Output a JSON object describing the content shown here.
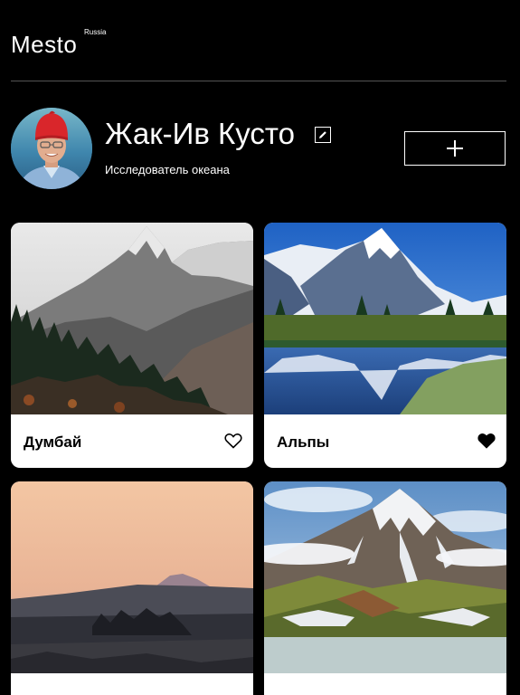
{
  "header": {
    "logo": "Mesto",
    "logo_sub": "Russia"
  },
  "profile": {
    "name": "Жак-Ив Кусто",
    "about": "Исследователь океана",
    "edit_icon": "pencil-icon",
    "add_icon": "plus-icon"
  },
  "cards": [
    {
      "title": "Думбай",
      "liked": false
    },
    {
      "title": "Альпы",
      "liked": true
    },
    {
      "title": "",
      "liked": false
    },
    {
      "title": "",
      "liked": false
    }
  ],
  "colors": {
    "background": "#000000",
    "card": "#ffffff",
    "text_dark": "#000000",
    "divider": "#545454"
  }
}
